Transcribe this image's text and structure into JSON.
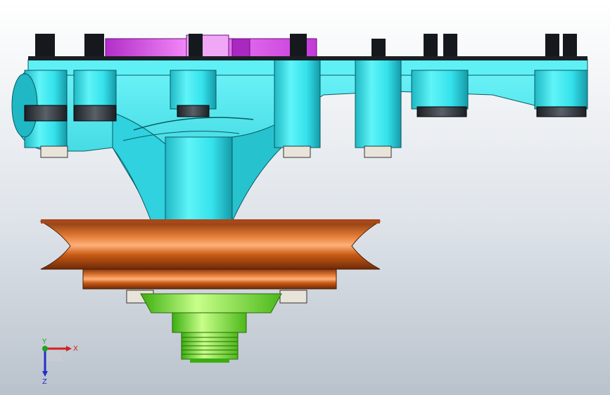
{
  "viewport": {
    "background_top": "#ffffff",
    "background_bottom": "#b9c2cc"
  },
  "model": {
    "parts": [
      {
        "name": "housing",
        "color": "#35e6ef"
      },
      {
        "name": "top-plate",
        "color": "#e652f0"
      },
      {
        "name": "pulley",
        "color": "#c85a14"
      },
      {
        "name": "hub",
        "color": "#7ef02c"
      },
      {
        "name": "nut",
        "color": "#2e3338"
      },
      {
        "name": "bolt-head",
        "color": "#e8e4da"
      }
    ]
  },
  "triad": {
    "x_label": "X",
    "y_label": "Y",
    "z_label": "Z",
    "x_color": "#d42020",
    "y_color": "#20a020",
    "z_color": "#2030c8"
  }
}
